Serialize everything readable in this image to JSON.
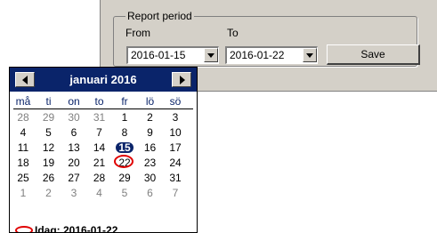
{
  "report": {
    "group_title": "Report period",
    "from_label": "From",
    "to_label": "To",
    "from_value": "2016-01-15",
    "to_value": "2016-01-22",
    "save_label": "Save"
  },
  "calendar": {
    "month_title": "januari 2016",
    "weekdays": [
      "må",
      "ti",
      "on",
      "to",
      "fr",
      "lö",
      "sö"
    ],
    "weeks": [
      [
        "28",
        "29",
        "30",
        "31",
        "1",
        "2",
        "3"
      ],
      [
        "4",
        "5",
        "6",
        "7",
        "8",
        "9",
        "10"
      ],
      [
        "11",
        "12",
        "13",
        "14",
        "15",
        "16",
        "17"
      ],
      [
        "18",
        "19",
        "20",
        "21",
        "22",
        "23",
        "24"
      ],
      [
        "25",
        "26",
        "27",
        "28",
        "29",
        "30",
        "31"
      ],
      [
        "1",
        "2",
        "3",
        "4",
        "5",
        "6",
        "7"
      ]
    ],
    "selected_day": "15",
    "today_day": "22",
    "today_text": "Idag: 2016-01-22",
    "colors": {
      "header": "#0a246a",
      "today_ring": "#e00000",
      "other_month": "#808080"
    }
  }
}
